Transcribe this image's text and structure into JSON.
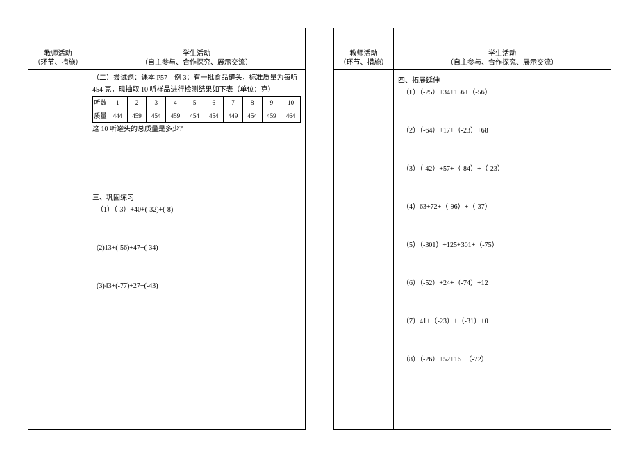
{
  "left_page": {
    "teacher_header_l1": "教师活动",
    "teacher_header_l2": "（环节、措施）",
    "student_header_l1": "学生活动",
    "student_header_l2": "（自主参与、合作探究、展示交流）",
    "intro_line1": "（二）尝试题：课本 P57　例 3：有一批食品罐头，标准质量为每听",
    "intro_line2": "454 克，现抽取 10 听样品进行检测结果如下表（单位：克）",
    "table_row1_head": "听数",
    "table_row1": [
      "1",
      "2",
      "3",
      "4",
      "5",
      "6",
      "7",
      "8",
      "9",
      "10"
    ],
    "table_row2_head": "质量",
    "table_row2": [
      "444",
      "459",
      "454",
      "459",
      "454",
      "454",
      "449",
      "454",
      "459",
      "464"
    ],
    "question": "这 10 听罐头的总质量是多少？",
    "sec3_title": "三、巩固练习",
    "p1": "（1）（-3）+40+(-32)+(-8)",
    "p2": "(2)13+(-56)+47+(-34)",
    "p3": "(3)43+(-77)+27+(-43)"
  },
  "right_page": {
    "teacher_header_l1": "教师活动",
    "teacher_header_l2": "（环节、措施）",
    "student_header_l1": "学生活动",
    "student_header_l2": "（自主参与、合作探究、展示交流）",
    "sec4_title": "四、拓展延伸",
    "q1": "（1）（-25）+34+156+（-56）",
    "q2": "（2）（-64）+17+（-23）+68",
    "q3": "（3）（-42）+57+（-84）+（-23）",
    "q4": "（4）63+72+（-96）+（-37）",
    "q5": "（5）（-301）+125+301+（-75）",
    "q6": "（6）（-52）+24+（-74）+12",
    "q7": "（7）41+（-23）+（-31）+0",
    "q8": "（8）（-26）+52+16+（-72）"
  }
}
